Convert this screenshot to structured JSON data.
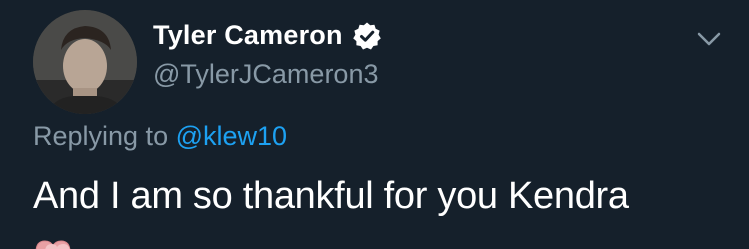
{
  "tweet": {
    "author": {
      "display_name": "Tyler Cameron",
      "handle": "@TylerJCameron3",
      "verified": true,
      "avatar_icon": "profile-photo"
    },
    "reply": {
      "prefix": "Replying to",
      "mention": "@klew10"
    },
    "text": "And I am so thankful for you Kendra",
    "trailing_emoji_icon": "two-hearts-emoji",
    "menu_icon": "chevron-down-icon"
  },
  "colors": {
    "background": "#15202b",
    "primary_text": "#ffffff",
    "secondary_text": "#8899a6",
    "accent": "#1da1f2",
    "emoji": "#e8a0a4"
  }
}
